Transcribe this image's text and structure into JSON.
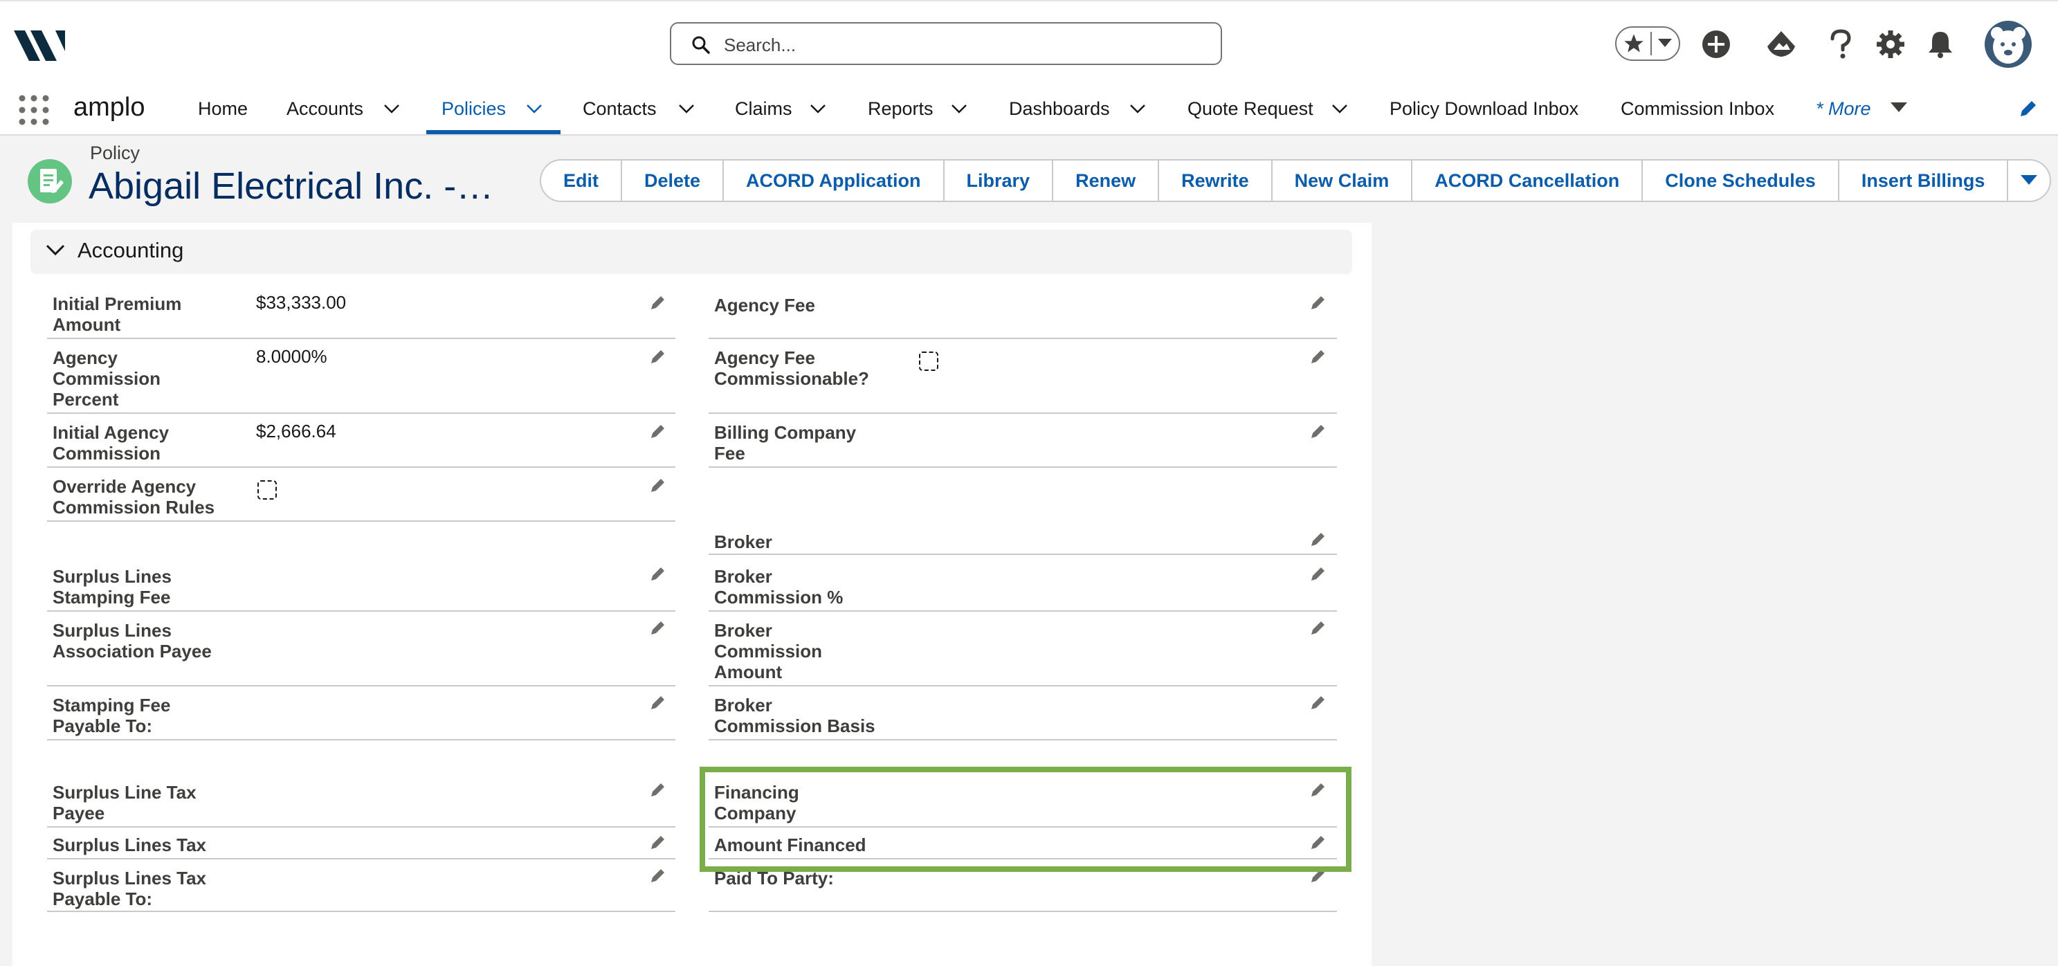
{
  "global_header": {
    "search_placeholder": "Search...",
    "icons": [
      "favorites-star-icon",
      "add-icon",
      "trailhead-icon",
      "help-icon",
      "setup-gear-icon",
      "notification-bell-icon",
      "user-avatar"
    ]
  },
  "nav": {
    "app_name": "amplo",
    "items": [
      {
        "label": "Home"
      },
      {
        "label": "Accounts"
      },
      {
        "label": "Policies"
      },
      {
        "label": "Contacts"
      },
      {
        "label": "Claims"
      },
      {
        "label": "Reports"
      },
      {
        "label": "Dashboards"
      },
      {
        "label": "Quote Request"
      },
      {
        "label": "Policy Download Inbox"
      },
      {
        "label": "Commission Inbox"
      },
      {
        "label": "* More"
      }
    ],
    "active": "Policies"
  },
  "record": {
    "object_type": "Policy",
    "title": "Abigail Electrical Inc. -…",
    "actions": [
      "Edit",
      "Delete",
      "ACORD Application",
      "Library",
      "Renew",
      "Rewrite",
      "New Claim",
      "ACORD Cancellation",
      "Clone Schedules",
      "Insert Billings"
    ]
  },
  "section": {
    "title": "Accounting",
    "left": [
      {
        "label_lines": [
          "Initial Premium",
          "Amount"
        ],
        "value": "$33,333.00"
      },
      {
        "label_lines": [
          "Agency",
          "Commission",
          "Percent"
        ],
        "value": "8.0000%"
      },
      {
        "label_lines": [
          "Initial Agency",
          "Commission"
        ],
        "value": "$2,666.64"
      },
      {
        "label_lines": [
          "Override Agency",
          "Commission Rules"
        ],
        "value": ""
      },
      {
        "label_lines": [
          "Surplus Lines",
          "Stamping Fee"
        ],
        "value": ""
      },
      {
        "label_lines": [
          "Surplus Lines",
          "Association Payee"
        ],
        "value": ""
      },
      {
        "label_lines": [
          "Stamping Fee",
          "Payable To:"
        ],
        "value": ""
      },
      {
        "label_lines": [
          "Surplus Line Tax",
          "Payee"
        ],
        "value": ""
      },
      {
        "label_lines": [
          "Surplus Lines Tax"
        ],
        "value": ""
      },
      {
        "label_lines": [
          "Surplus Lines Tax",
          "Payable To:"
        ],
        "value": ""
      }
    ],
    "right": [
      {
        "label_lines": [
          "Agency Fee"
        ],
        "value": ""
      },
      {
        "label_lines": [
          "Agency Fee",
          "Commissionable?"
        ],
        "value": ""
      },
      {
        "label_lines": [
          "Billing Company",
          "Fee"
        ],
        "value": ""
      },
      {
        "label_lines": [
          "Broker"
        ],
        "value": ""
      },
      {
        "label_lines": [
          "Broker",
          "Commission %"
        ],
        "value": ""
      },
      {
        "label_lines": [
          "Broker",
          "Commission",
          "Amount"
        ],
        "value": ""
      },
      {
        "label_lines": [
          "Broker",
          "Commission Basis"
        ],
        "value": ""
      },
      {
        "label_lines": [
          "Financing",
          "Company"
        ],
        "value": ""
      },
      {
        "label_lines": [
          "Amount Financed"
        ],
        "value": ""
      },
      {
        "label_lines": [
          "Paid To Party:"
        ],
        "value": ""
      }
    ]
  },
  "highlight_color": "#7cad4b",
  "brand_color": "#0b5cab"
}
